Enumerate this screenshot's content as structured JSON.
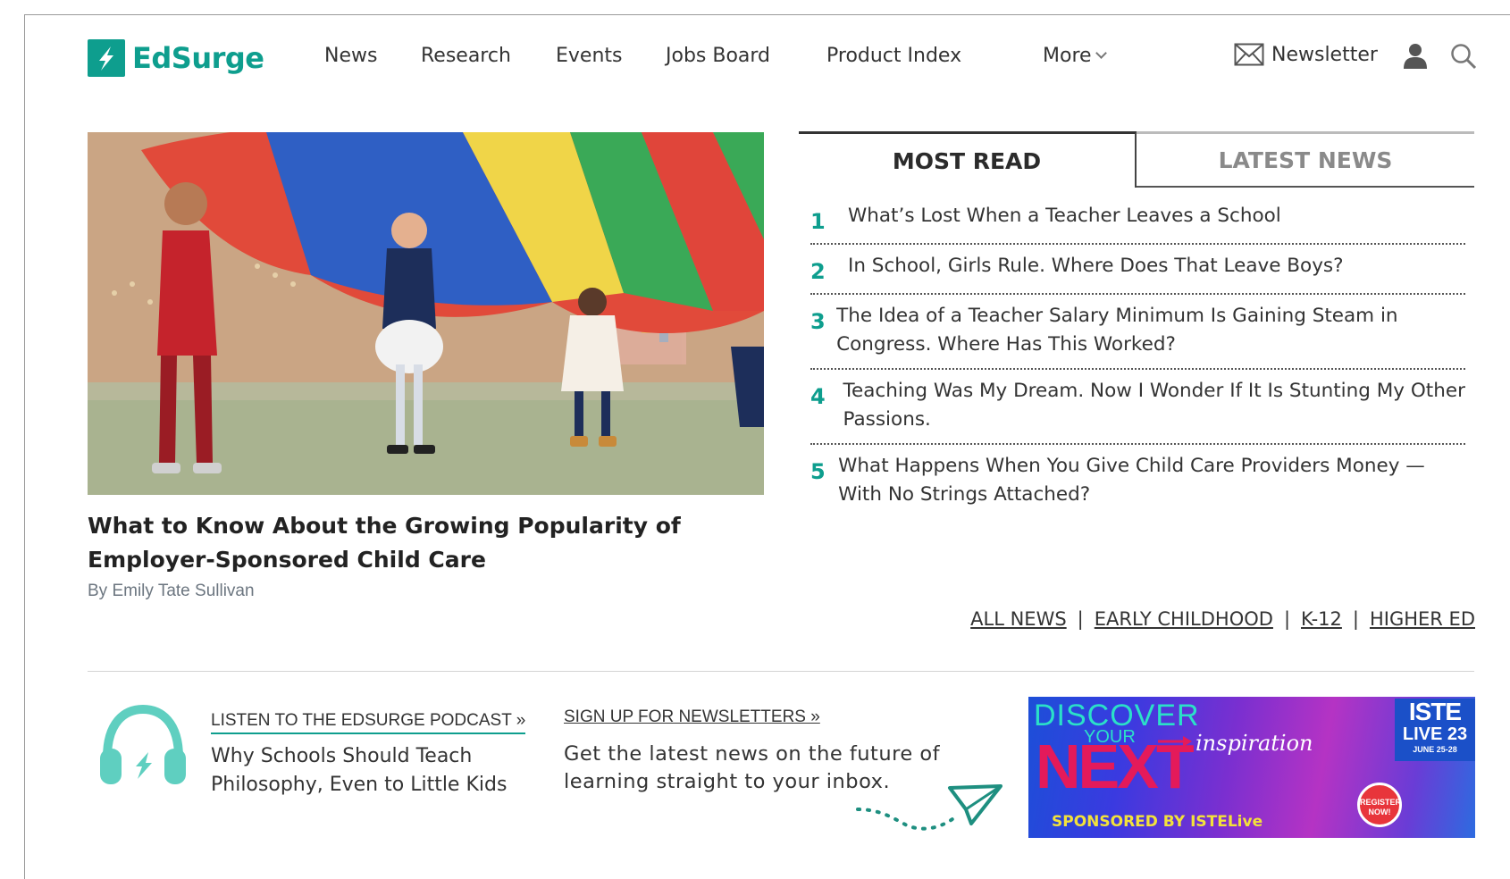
{
  "brand": {
    "name": "EdSurge",
    "color": "#0e9e8e"
  },
  "nav": {
    "items": [
      "News",
      "Research",
      "Events",
      "Jobs Board",
      "Product Index",
      "More"
    ],
    "newsletter_label": "Newsletter"
  },
  "hero": {
    "title": "What to Know About the Growing Popularity of Employer-Sponsored Child Care",
    "author": "By Emily Tate Sullivan"
  },
  "tabs": {
    "most_read": "MOST READ",
    "latest_news": "LATEST NEWS"
  },
  "most_read": [
    {
      "num": "1",
      "title": "What’s Lost When a Teacher Leaves a School"
    },
    {
      "num": "2",
      "title": "In School, Girls Rule. Where Does That Leave Boys?"
    },
    {
      "num": "3",
      "title": "The Idea of a Teacher Salary Minimum Is Gaining Steam in Congress. Where Has This Worked?"
    },
    {
      "num": "4",
      "title": "Teaching Was My Dream. Now I Wonder If It Is Stunting My Other Passions."
    },
    {
      "num": "5",
      "title": "What Happens When You Give Child Care Providers Money — With No Strings Attached?"
    }
  ],
  "categories": {
    "all_news": "ALL NEWS",
    "early_childhood": "EARLY CHILDHOOD",
    "k12": "K-12",
    "higher_ed": "HIGHER ED",
    "separator": "|"
  },
  "podcast": {
    "link": "LISTEN TO THE EDSURGE PODCAST »",
    "title": "Why Schools Should Teach Philosophy, Even to Little Kids"
  },
  "newsletter_signup": {
    "link": "SIGN UP FOR NEWSLETTERS »",
    "text": "Get the latest news on the future of learning straight to your inbox."
  },
  "ad": {
    "discover": "DISCOVER",
    "your": "YOUR",
    "next": "NEXT",
    "inspiration": "inspiration",
    "iste": "ISTE",
    "live": "LIVE 23",
    "dates": "JUNE 25-28",
    "register": "REGISTER NOW!",
    "sponsored": "SPONSORED BY ISTELive"
  }
}
